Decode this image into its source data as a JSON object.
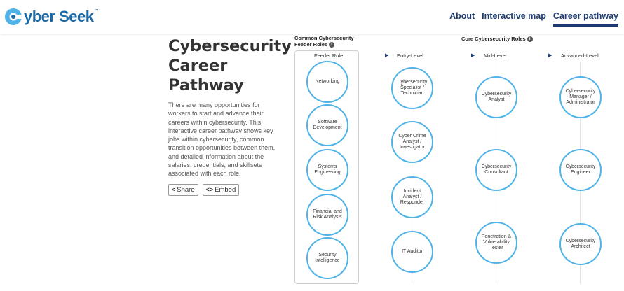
{
  "header": {
    "logo": {
      "text_prefix": "C",
      "text_rest": "yber Seek",
      "tm": "™"
    },
    "nav": [
      {
        "label": "About",
        "active": false
      },
      {
        "label": "Interactive map",
        "active": false
      },
      {
        "label": "Career pathway",
        "active": true
      }
    ]
  },
  "intro": {
    "title": "Cybersecurity Career Pathway",
    "description": "There are many opportunities for workers to start and advance their careers within cybersecurity. This interactive career pathway shows key jobs within cybersecurity, common transition opportunities between them, and detailed information about the salaries, credentials, and skillsets associated with each role.",
    "share_label": "Share",
    "embed_label": "Embed"
  },
  "feeder": {
    "title_line1": "Common Cybersecurity",
    "title_line2": "Feeder Roles",
    "column_label": "Feeder Role",
    "roles": [
      "Networking",
      "Software Development",
      "Systems Engineering",
      "Financial and Risk Analysis",
      "Security Intelligence"
    ]
  },
  "core": {
    "title": "Core Cybersecurity Roles",
    "entry_label": "Entry-Level",
    "mid_label": "Mid-Level",
    "advanced_label": "Advanced-Level",
    "entry_roles": [
      "Cybersecurity Specialist / Technician",
      "Cyber Crime Analyst / Investigator",
      "Incident Analyst / Responder",
      "IT Auditor"
    ],
    "mid_roles": [
      "Cybersecurity Analyst",
      "Cybersecurity Consultant",
      "Penetration & Vulnerability Tester"
    ],
    "advanced_roles": [
      "Cybersecurity Manager / Administrator",
      "Cybersecurity Engineer",
      "Cybersecurity Architect"
    ]
  },
  "colors": {
    "accent": "#4fb3e8",
    "nav": "#1c3b72",
    "logo": "#1a6aa8"
  }
}
